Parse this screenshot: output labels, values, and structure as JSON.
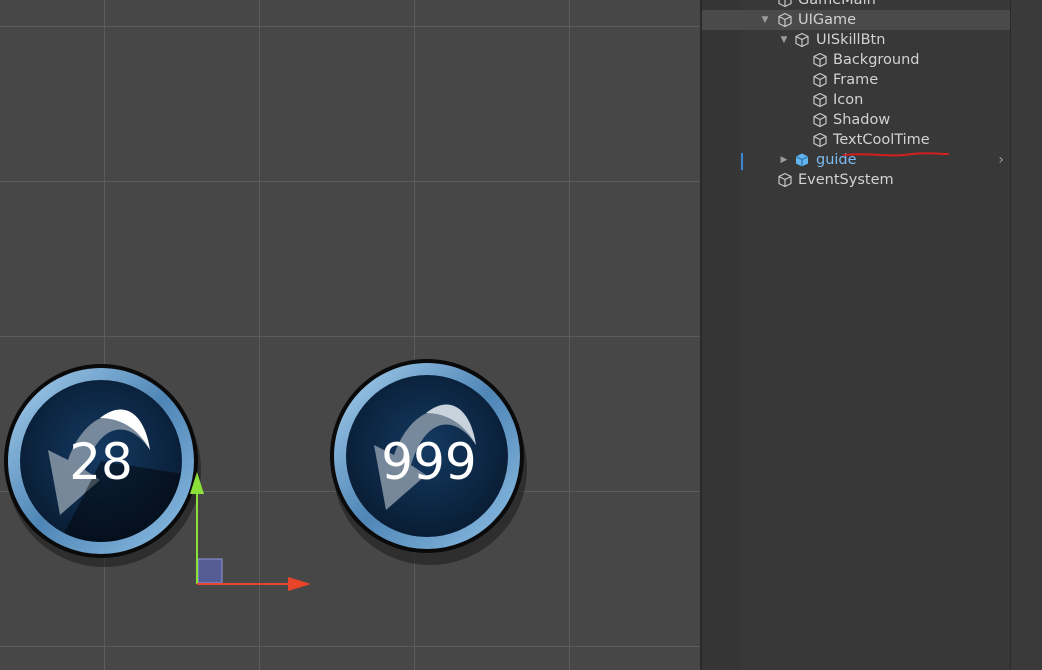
{
  "scene_view": {
    "skill_buttons": [
      {
        "cooldown_text": "28",
        "cooldown_fill": 0.3
      },
      {
        "cooldown_text": "999",
        "cooldown_fill": 0
      }
    ],
    "colors": {
      "background": "#474747",
      "grid": "#5c5c5c",
      "gizmo_x": "#e8452a",
      "gizmo_y": "#8be03a",
      "ring": "#6fa3cf",
      "icon_bg": "#0c2340"
    }
  },
  "hierarchy": {
    "items": [
      {
        "label": "GameMain",
        "icon": "gameobject-cube-icon"
      },
      {
        "label": "UIGame",
        "icon": "gameobject-cube-icon",
        "expanded": true,
        "selected": true
      },
      {
        "label": "UISkillBtn",
        "icon": "gameobject-cube-icon",
        "expanded": true
      },
      {
        "label": "Background",
        "icon": "gameobject-cube-icon"
      },
      {
        "label": "Frame",
        "icon": "gameobject-cube-icon"
      },
      {
        "label": "Icon",
        "icon": "gameobject-cube-icon"
      },
      {
        "label": "Shadow",
        "icon": "gameobject-cube-icon"
      },
      {
        "label": "TextCoolTime",
        "icon": "gameobject-cube-icon",
        "annotated": true
      },
      {
        "label": "guide",
        "icon": "prefab-cube-icon",
        "collapsed": true,
        "prefab": true
      },
      {
        "label": "EventSystem",
        "icon": "gameobject-cube-icon"
      }
    ],
    "colors": {
      "text": "#d2d2d2",
      "prefab_text": "#7cb9f0",
      "annotation": "#d11f1f"
    }
  }
}
